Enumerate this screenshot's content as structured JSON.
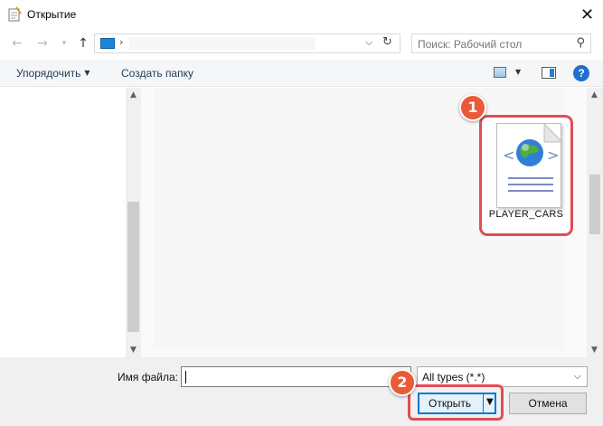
{
  "window": {
    "title": "Открытие"
  },
  "nav": {
    "back_icon": "arrow-left-icon",
    "forward_icon": "arrow-right-icon",
    "recent_icon": "chevron-down-icon",
    "up_icon": "arrow-up-icon",
    "address": {
      "location_icon": "computer-icon",
      "separator": "›"
    },
    "search_placeholder": "Поиск: Рабочий стол"
  },
  "toolbar": {
    "organize_label": "Упорядочить",
    "new_folder_label": "Создать папку"
  },
  "files": [
    {
      "name": "PLAYER_CARS",
      "icon": "html-document-globe-icon"
    }
  ],
  "annotations": {
    "marker_1": "1",
    "marker_2": "2",
    "marker_color": "#ea5a36",
    "highlight_color": "#e04e54"
  },
  "footer": {
    "filename_label": "Имя файла:",
    "filename_value": "",
    "filetype_selected": "All types (*.*)",
    "open_label": "Открыть",
    "cancel_label": "Отмена"
  },
  "colors": {
    "accent": "#0078d7",
    "help": "#1f6fd0"
  }
}
